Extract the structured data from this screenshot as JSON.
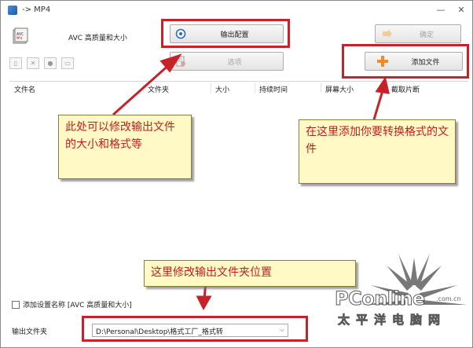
{
  "window": {
    "title": "-> MP4"
  },
  "profile": {
    "label": "AVC 高质量和大小"
  },
  "buttons": {
    "output_settings": "输出配置",
    "options": "选项",
    "ok": "确定",
    "add_file": "添加文件"
  },
  "file_list": {
    "columns": [
      "文件名",
      "文件夹",
      "大小",
      "持续时间",
      "屏幕大小",
      "截取片断"
    ]
  },
  "footer": {
    "checkbox_label": "添加设置名称 [AVC 高质量和大小]",
    "output_folder_label": "输出文件夹",
    "output_folder_value": "D:\\Personal\\Desktop\\格式工厂_格式转"
  },
  "annotations": {
    "left_callout": "此处可以修改输出文件的大小和格式等",
    "right_callout": "在这里添加你要转换格式的文件",
    "bottom_callout": "这里修改输出文件夹位置"
  },
  "watermark": {
    "logo": "PConline",
    "domain": ".com.cn",
    "tagline": "太平洋电脑网"
  },
  "colors": {
    "annotation_red": "#c7212a",
    "callout_bg": "#fff9c6",
    "add_icon": "#f08a24"
  },
  "icons": [
    "app-icon",
    "minimize-icon",
    "close-icon",
    "output-settings-icon",
    "options-icon",
    "ok-icon",
    "add-file-plus-icon",
    "dropdown-chevron-icon"
  ]
}
